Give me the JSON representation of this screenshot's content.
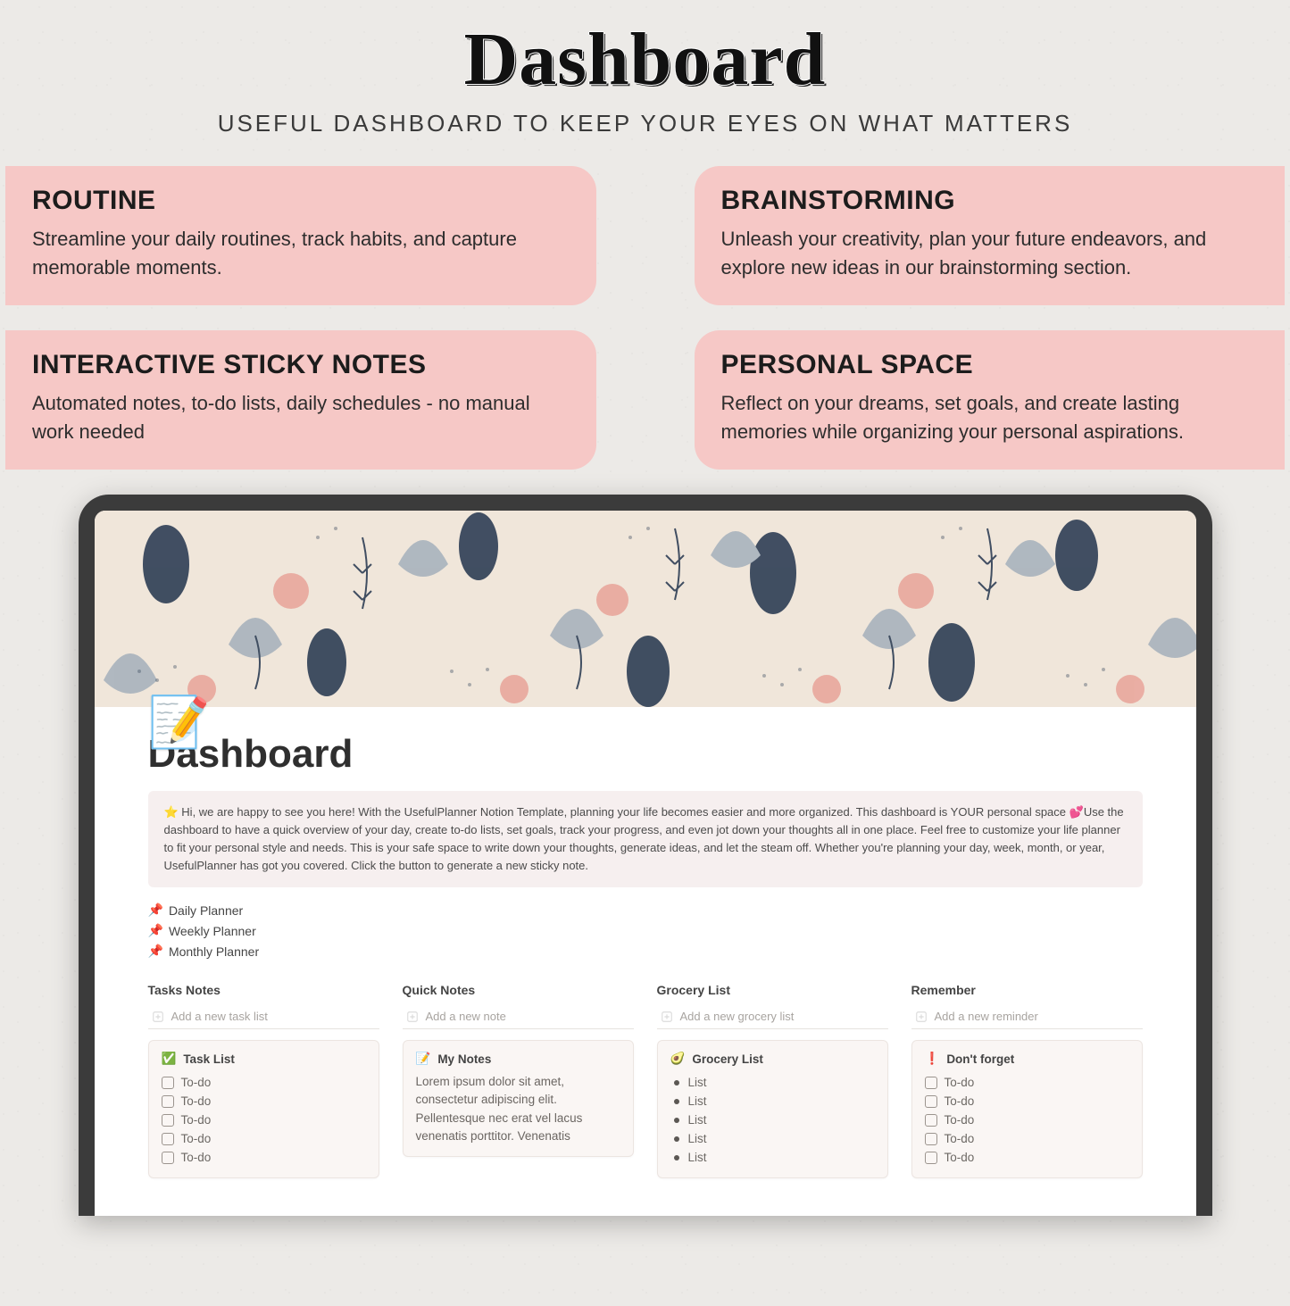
{
  "headline": "Dashboard",
  "subhead": "USEFUL DASHBOARD TO KEEP YOUR EYES ON WHAT MATTERS",
  "features": [
    {
      "title": "ROUTINE",
      "body": "Streamline your daily routines, track habits, and capture memorable moments."
    },
    {
      "title": "BRAINSTORMING",
      "body": "Unleash your creativity, plan your future endeavors, and explore new ideas in our brainstorming section."
    },
    {
      "title": "INTERACTIVE STICKY NOTES",
      "body": "Automated notes, to-do lists, daily schedules - no manual work needed"
    },
    {
      "title": "PERSONAL SPACE",
      "body": "Reflect on your dreams, set goals, and create lasting memories while organizing your personal aspirations."
    }
  ],
  "notion": {
    "page_icon": "📝",
    "page_title": "Dashboard",
    "callout": "⭐ Hi, we are happy to see you here! With the UsefulPlanner Notion Template, planning your life becomes easier and more organized. This dashboard is YOUR personal space 💕Use the dashboard to have a quick overview of your day, create to-do lists, set goals, track your progress, and even jot down your thoughts all in one place. Feel free to customize your life planner to fit your personal style and needs. This is your safe space to write down your thoughts, generate ideas, and let the steam off. Whether you're planning your day, week, month, or year, UsefulPlanner has got you covered. Click the button to generate a new sticky note.",
    "planner_links": [
      {
        "icon": "📌",
        "label": "Daily Planner"
      },
      {
        "icon": "📌",
        "label": "Weekly Planner"
      },
      {
        "icon": "📌",
        "label": "Monthly Planner"
      }
    ],
    "columns": [
      {
        "title": "Tasks Notes",
        "add_placeholder": "Add a new task list",
        "card": {
          "icon": "✅",
          "title": "Task List",
          "type": "todo",
          "items": [
            "To-do",
            "To-do",
            "To-do",
            "To-do",
            "To-do"
          ]
        }
      },
      {
        "title": "Quick Notes",
        "add_placeholder": "Add a new note",
        "card": {
          "icon": "📝",
          "title": "My Notes",
          "type": "text",
          "body": "Lorem ipsum dolor sit amet, consectetur adipiscing elit. Pellentesque nec erat vel lacus venenatis porttitor. Venenatis"
        }
      },
      {
        "title": "Grocery List",
        "add_placeholder": "Add a new grocery list",
        "card": {
          "icon": "🥑",
          "title": "Grocery List",
          "type": "bullet",
          "items": [
            "List",
            "List",
            "List",
            "List",
            "List"
          ]
        }
      },
      {
        "title": "Remember",
        "add_placeholder": "Add a new reminder",
        "card": {
          "icon": "❗",
          "title": "Don't forget",
          "type": "todo",
          "items": [
            "To-do",
            "To-do",
            "To-do",
            "To-do",
            "To-do"
          ]
        }
      }
    ]
  }
}
